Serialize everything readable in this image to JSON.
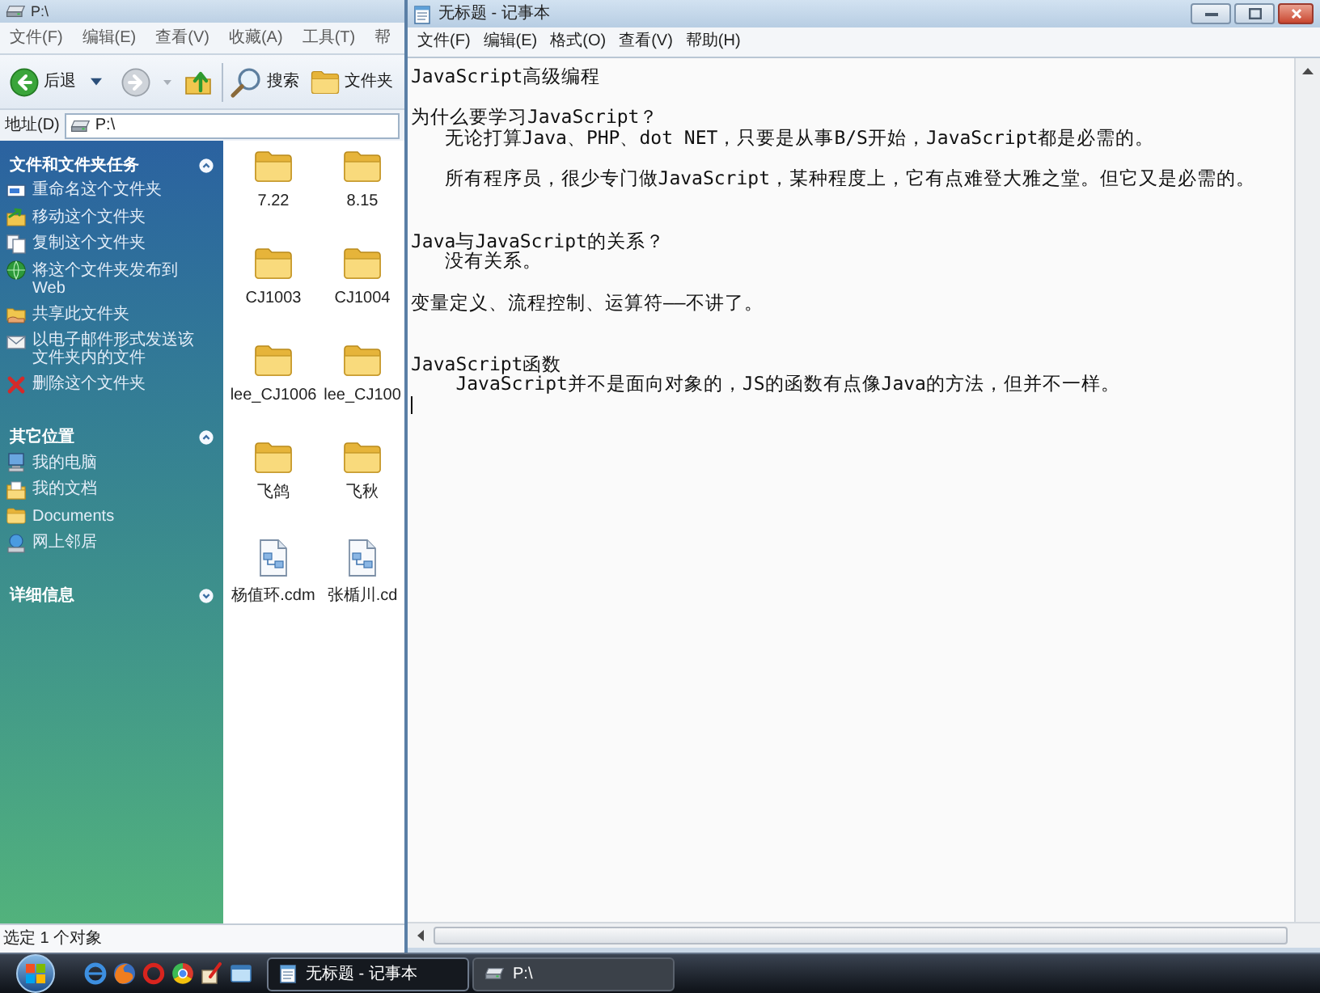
{
  "explorer": {
    "title": "P:\\",
    "menu": [
      "文件(F)",
      "编辑(E)",
      "查看(V)",
      "收藏(A)",
      "工具(T)",
      "帮"
    ],
    "toolbar": [
      {
        "kind": "back",
        "label": "后退",
        "disabled": false
      },
      {
        "kind": "forward",
        "disabled": true
      },
      {
        "kind": "up",
        "disabled": false
      },
      {
        "kind": "search",
        "label": "搜索",
        "disabled": false
      },
      {
        "kind": "folders",
        "label": "文件夹",
        "disabled": false
      }
    ],
    "address": {
      "label": "地址(D)",
      "value": "P:\\"
    },
    "task_panes": [
      {
        "title": "文件和文件夹任务",
        "expanded": true,
        "items": [
          {
            "kind": "rename",
            "label": "重命名这个文件夹"
          },
          {
            "kind": "move",
            "label": "移动这个文件夹"
          },
          {
            "kind": "copy",
            "label": "复制这个文件夹"
          },
          {
            "kind": "publish",
            "label": "将这个文件夹发布到 Web"
          },
          {
            "kind": "share",
            "label": "共享此文件夹"
          },
          {
            "kind": "email",
            "label": "以电子邮件形式发送该文件夹内的文件"
          },
          {
            "kind": "delete",
            "label": "删除这个文件夹"
          }
        ]
      },
      {
        "title": "其它位置",
        "expanded": true,
        "items": [
          {
            "kind": "computer",
            "label": "我的电脑"
          },
          {
            "kind": "documents",
            "label": "我的文档"
          },
          {
            "kind": "folder",
            "label": "Documents"
          },
          {
            "kind": "network",
            "label": "网上邻居"
          }
        ]
      },
      {
        "title": "详细信息",
        "expanded": false
      }
    ],
    "files": [
      {
        "kind": "folder",
        "name": "7.22"
      },
      {
        "kind": "folder",
        "name": "8.15"
      },
      {
        "kind": "folder",
        "name": "CJ1003"
      },
      {
        "kind": "folder",
        "name": "CJ1004"
      },
      {
        "kind": "folder",
        "name": "lee_CJ1006"
      },
      {
        "kind": "folder",
        "name": "lee_CJ100"
      },
      {
        "kind": "folder",
        "name": "飞鸽"
      },
      {
        "kind": "folder",
        "name": "飞秋"
      },
      {
        "kind": "diagram",
        "name": "杨值环.cdm"
      },
      {
        "kind": "diagram",
        "name": "张楯川.cd"
      }
    ],
    "status_bar": "选定 1 个对象"
  },
  "notepad": {
    "title": "无标题 - 记事本",
    "menu": [
      "文件(F)",
      "编辑(E)",
      "格式(O)",
      "查看(V)",
      "帮助(H)"
    ],
    "lines": [
      {
        "kind": "text",
        "text": "JavaScript高级编程"
      },
      {
        "kind": "blank"
      },
      {
        "kind": "text",
        "text": "为什么要学习JavaScript？"
      },
      {
        "kind": "text",
        "text": "   无论打算Java、PHP、dot NET，只要是从事B/S开始，JavaScript都是必需的。"
      },
      {
        "kind": "blank"
      },
      {
        "kind": "text",
        "text": "   所有程序员，很少专门做JavaScript，某种程度上，它有点难登大雅之堂。但它又是必需的。"
      },
      {
        "kind": "blank"
      },
      {
        "kind": "blank"
      },
      {
        "kind": "text",
        "text": "Java与JavaScript的关系？"
      },
      {
        "kind": "text",
        "text": "   没有关系。"
      },
      {
        "kind": "blank"
      },
      {
        "kind": "text",
        "text": "变量定义、流程控制、运算符——不讲了。"
      },
      {
        "kind": "blank"
      },
      {
        "kind": "blank"
      },
      {
        "kind": "text",
        "text": "JavaScript函数"
      },
      {
        "kind": "text",
        "text": "    JavaScript并不是面向对象的，JS的函数有点像Java的方法，但并不一样。"
      }
    ]
  },
  "taskbar": {
    "tasks": [
      {
        "kind": "notepad",
        "label": "无标题 - 记事本",
        "selected": true
      },
      {
        "kind": "drive",
        "label": "P:\\",
        "selected": false
      }
    ]
  }
}
